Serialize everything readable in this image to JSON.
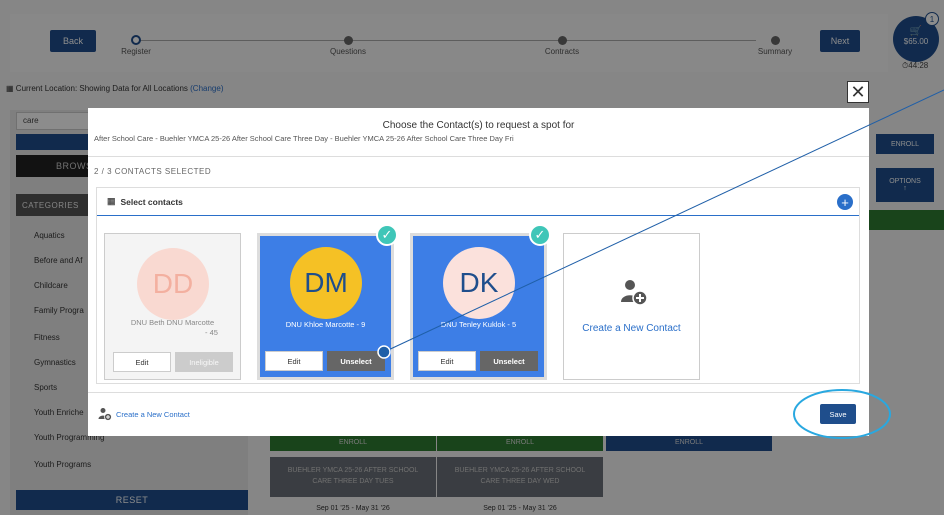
{
  "header": {
    "back_label": "Back",
    "next_label": "Next",
    "steps": [
      {
        "label": "Register"
      },
      {
        "label": "Questions"
      },
      {
        "label": "Contracts"
      },
      {
        "label": "Summary"
      }
    ],
    "cart_total": "$65.00",
    "cart_count": "1",
    "timer": "⏱44:28"
  },
  "location": {
    "text": "Current Location: Showing Data for All Locations",
    "change_label": "(Change)"
  },
  "sidebar": {
    "search_value": "care",
    "browse_label": "BROWS",
    "categories_header": "CATEGORIES",
    "categories": [
      "Aquatics",
      "Before and Af",
      "Childcare",
      "Family Progra",
      "Fitness",
      "Gymnastics",
      "Sports",
      "Youth Enriche",
      "Youth Programming",
      "Youth Programs"
    ],
    "reset_label": "RESET"
  },
  "right_controls": {
    "enroll_label": "ENROLL",
    "options_label": "OPTIONS",
    "options_arrow": "↑"
  },
  "background_cards": {
    "enroll_label": "ENROLL",
    "card1_title": "BUEHLER YMCA 25-26 AFTER SCHOOL CARE THREE DAY TUES",
    "card2_title": "BUEHLER YMCA 25-26 AFTER SCHOOL CARE THREE DAY WED",
    "card_date": "Sep 01 '25 - May 31 '26"
  },
  "modal": {
    "close_label": "✕",
    "title": "Choose the Contact(s) to request a spot for",
    "subtitle": "After School Care - Buehler YMCA 25-26 After School Care Three Day - Buehler YMCA 25-26 After School Care Three Day Fri",
    "selected_count": "2 / 3 CONTACTS SELECTED",
    "panel_title": "Select contacts",
    "plus_label": "+",
    "contacts": [
      {
        "initials": "DD",
        "name": "DNU Beth DNU Marcotte",
        "age": "- 45",
        "edit_label": "Edit",
        "action_label": "Ineligible"
      },
      {
        "initials": "DM",
        "name": "DNU Khloe Marcotte - 9",
        "edit_label": "Edit",
        "action_label": "Unselect"
      },
      {
        "initials": "DK",
        "name": "DNU Tenley Kuklok - 5",
        "edit_label": "Edit",
        "action_label": "Unselect"
      }
    ],
    "create_card_label": "Create a New Contact",
    "footer_create_label": "Create a New Contact",
    "save_label": "Save",
    "checkmark": "✓"
  },
  "colors": {
    "primary": "#1f4e8c",
    "link": "#2a6fc9",
    "selected_card": "#3d7ee6",
    "check": "#3fc6b8",
    "green": "#2e7d32",
    "annotation": "#29a8e0"
  }
}
